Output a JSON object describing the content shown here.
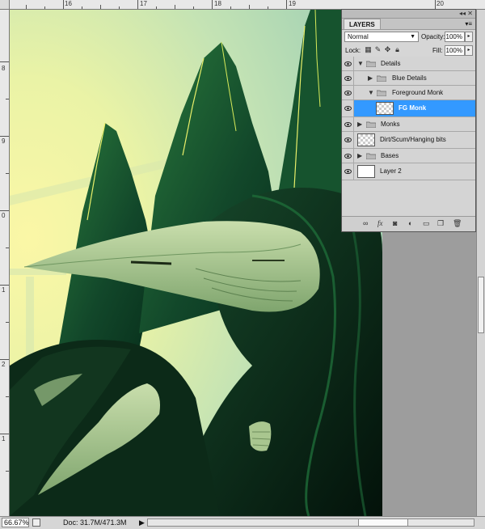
{
  "rulers": {
    "top_labels": [
      "16",
      "17",
      "18",
      "19",
      "20"
    ],
    "left_labels": [
      "8",
      "9",
      "0",
      "1",
      "2",
      "1"
    ]
  },
  "layers_panel": {
    "tab_label": "LAYERS",
    "blend_mode": "Normal",
    "opacity_label": "Opacity:",
    "opacity_value": "100%",
    "lock_label": "Lock:",
    "fill_label": "Fill:",
    "fill_value": "100%",
    "layers": [
      {
        "name": "Details",
        "kind": "group",
        "expanded": true,
        "indent": 0,
        "selected": false
      },
      {
        "name": "Blue Details",
        "kind": "group",
        "expanded": false,
        "indent": 1,
        "selected": false
      },
      {
        "name": "Foreground Monk",
        "kind": "group",
        "expanded": true,
        "indent": 1,
        "selected": false
      },
      {
        "name": "FG Monk",
        "kind": "layer",
        "indent": 2,
        "selected": true
      },
      {
        "name": "Monks",
        "kind": "group",
        "expanded": false,
        "indent": 0,
        "selected": false
      },
      {
        "name": "Dirt/Scum/Hanging bits",
        "kind": "layer",
        "indent": 0,
        "selected": false
      },
      {
        "name": "Bases",
        "kind": "group",
        "expanded": false,
        "indent": 0,
        "selected": false
      },
      {
        "name": "Layer 2",
        "kind": "layer-white",
        "indent": 0,
        "selected": false
      }
    ],
    "bottom_icons": [
      "link-icon",
      "fx-icon",
      "mask-icon",
      "adjustment-icon",
      "new-group-icon",
      "new-layer-icon",
      "trash-icon"
    ]
  },
  "status_bar": {
    "zoom": "66.67%",
    "doc_info": "Doc: 31.7M/471.3M"
  },
  "colors": {
    "selection": "#3399ff",
    "panel_bg": "#d6d6d6"
  }
}
